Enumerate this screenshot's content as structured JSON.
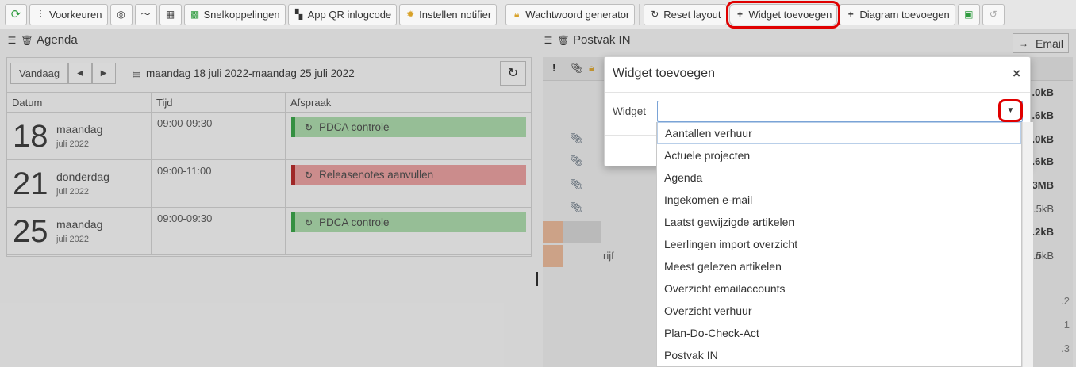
{
  "toolbar": {
    "preferences": "Voorkeuren",
    "shortcuts": "Snelkoppelingen",
    "qr": "App QR inlogcode",
    "notifier": "Instellen notifier",
    "password": "Wachtwoord generator",
    "reset": "Reset layout",
    "add_widget": "Widget toevoegen",
    "add_diagram": "Diagram toevoegen"
  },
  "agenda": {
    "title": "Agenda",
    "today": "Vandaag",
    "range": "maandag 18 juli 2022-maandag 25 juli 2022",
    "columns": [
      "Datum",
      "Tijd",
      "Afspraak"
    ],
    "rows": [
      {
        "day": "18",
        "dayname": "maandag",
        "month": "juli 2022",
        "time": "09:00-09:30",
        "appointment": "PDCA controle",
        "status": "green"
      },
      {
        "day": "21",
        "dayname": "donderdag",
        "month": "juli 2022",
        "time": "09:00-11:00",
        "appointment": "Releasenotes aanvullen",
        "status": "red"
      },
      {
        "day": "25",
        "dayname": "maandag",
        "month": "juli 2022",
        "time": "09:00-09:30",
        "appointment": "PDCA controle",
        "status": "green"
      }
    ]
  },
  "postvak": {
    "title": "Postvak IN",
    "email_button": "Email",
    "header_marks": [
      "!"
    ],
    "sizes": [
      ".0kB",
      ".6kB",
      ".0kB",
      ".6kB",
      "3MB",
      "0.5kB",
      ".2kB",
      ".5kB"
    ],
    "partial_text": [
      "rijf",
      "m"
    ],
    "partial_right": [
      ".2",
      "1",
      ".3"
    ]
  },
  "modal": {
    "title": "Widget toevoegen",
    "close": "×",
    "label": "Widget",
    "value": "",
    "options": [
      "Aantallen verhuur",
      "Actuele projecten",
      "Agenda",
      "Ingekomen e-mail",
      "Laatst gewijzigde artikelen",
      "Leerlingen import overzicht",
      "Meest gelezen artikelen",
      "Overzicht emailaccounts",
      "Overzicht verhuur",
      "Plan-Do-Check-Act",
      "Postvak IN"
    ]
  },
  "colors": {
    "accent_green": "#2f9f3f",
    "accent_red": "#b21f1f",
    "highlight": "#e00000"
  }
}
